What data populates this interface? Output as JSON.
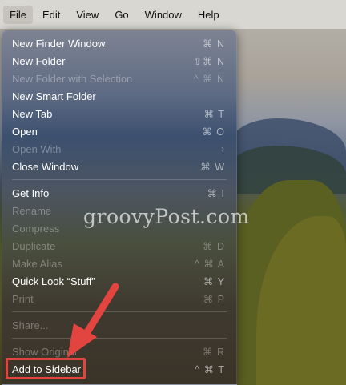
{
  "menubar": {
    "items": [
      {
        "label": "File"
      },
      {
        "label": "Edit"
      },
      {
        "label": "View"
      },
      {
        "label": "Go"
      },
      {
        "label": "Window"
      },
      {
        "label": "Help"
      }
    ]
  },
  "file_menu": {
    "items": [
      {
        "label": "New Finder Window",
        "shortcut": "⌘ N"
      },
      {
        "label": "New Folder",
        "shortcut": "⇧⌘ N"
      },
      {
        "label": "New Folder with Selection",
        "shortcut": "^ ⌘ N"
      },
      {
        "label": "New Smart Folder",
        "shortcut": ""
      },
      {
        "label": "New Tab",
        "shortcut": "⌘ T"
      },
      {
        "label": "Open",
        "shortcut": "⌘ O"
      },
      {
        "label": "Open With",
        "shortcut": "›"
      },
      {
        "label": "Close Window",
        "shortcut": "⌘ W"
      },
      {
        "label": "Get Info",
        "shortcut": "⌘ I"
      },
      {
        "label": "Rename",
        "shortcut": ""
      },
      {
        "label": "Compress",
        "shortcut": ""
      },
      {
        "label": "Duplicate",
        "shortcut": "⌘ D"
      },
      {
        "label": "Make Alias",
        "shortcut": "^ ⌘ A"
      },
      {
        "label": "Quick Look “Stuff”",
        "shortcut": "⌘ Y"
      },
      {
        "label": "Print",
        "shortcut": "⌘ P"
      },
      {
        "label": "Share...",
        "shortcut": ""
      },
      {
        "label": "Show Original",
        "shortcut": "⌘ R"
      },
      {
        "label": "Add to Sidebar",
        "shortcut": "^ ⌘ T"
      }
    ]
  },
  "watermark": "groovyPost.com",
  "colors": {
    "highlight": "#e2443f",
    "menu_text": "#ffffff",
    "disabled_text": "rgba(255,255,255,0.32)"
  }
}
